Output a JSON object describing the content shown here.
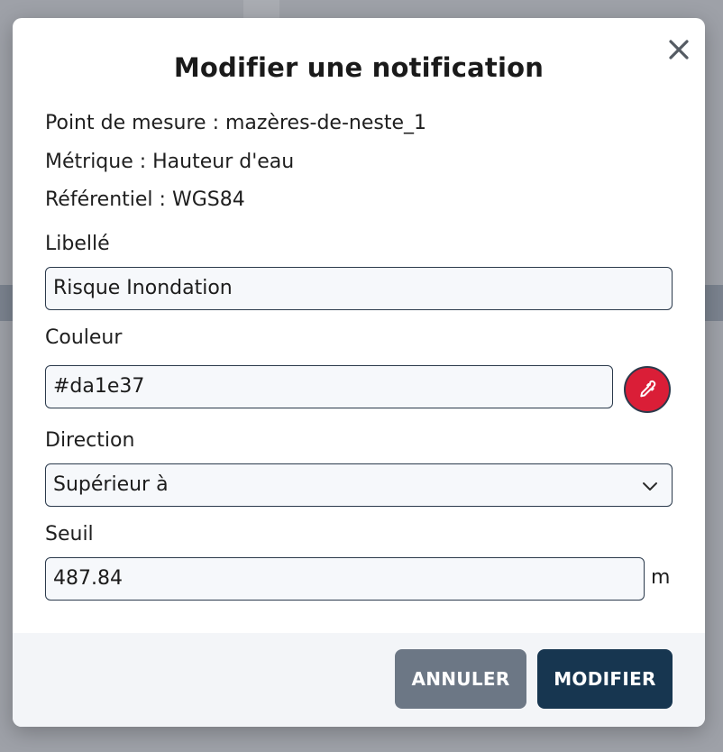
{
  "dialog": {
    "title": "Modifier une notification",
    "info": {
      "point": "Point de mesure : mazères-de-neste_1",
      "metric": "Métrique : Hauteur d'eau",
      "referential": "Référentiel : WGS84"
    },
    "fields": {
      "label_title": "Libellé",
      "label_value": "Risque Inondation",
      "color_title": "Couleur",
      "color_value": "#da1e37",
      "direction_title": "Direction",
      "direction_value": "Supérieur à",
      "threshold_title": "Seuil",
      "threshold_value": "487.84",
      "threshold_unit": "m"
    },
    "buttons": {
      "cancel": "ANNULER",
      "submit": "MODIFIER"
    },
    "icons": {
      "close": "close-icon",
      "picker": "eyedropper-icon",
      "chevron": "chevron-down-icon"
    },
    "colors": {
      "swatch": "#da1e37",
      "primary": "#173650",
      "secondary": "#6c7785"
    }
  }
}
